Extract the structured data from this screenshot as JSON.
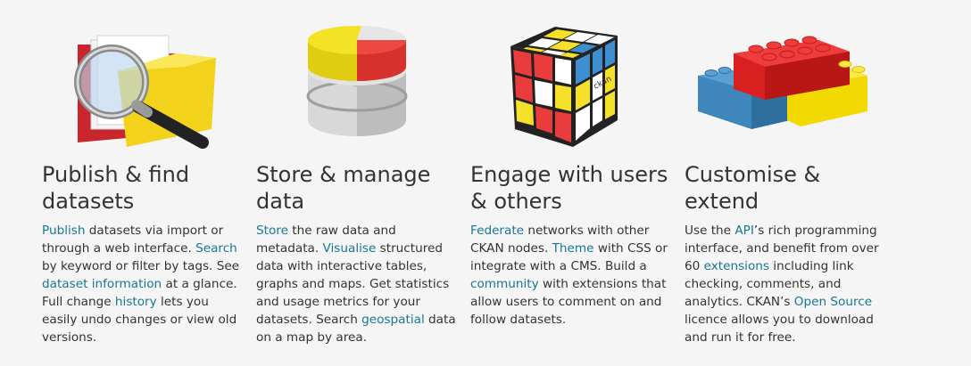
{
  "features": [
    {
      "title_line1": "Publish & find",
      "title_line2": "datasets",
      "icon": "folder-magnifier-icon",
      "desc": [
        {
          "t": "Publish",
          "link": true
        },
        {
          "t": " datasets via import or through a web interface. ",
          "link": false
        },
        {
          "t": "Search",
          "link": true
        },
        {
          "t": " by keyword or filter by tags. See ",
          "link": false
        },
        {
          "t": "dataset information",
          "link": true
        },
        {
          "t": " at a glance. Full change ",
          "link": false
        },
        {
          "t": "history",
          "link": true
        },
        {
          "t": " lets you easily undo changes or view old versions.",
          "link": false
        }
      ]
    },
    {
      "title_line1": "Store & manage",
      "title_line2": "data",
      "icon": "database-pie-icon",
      "desc": [
        {
          "t": "Store",
          "link": true
        },
        {
          "t": " the raw data and metadata. ",
          "link": false
        },
        {
          "t": "Visualise",
          "link": true
        },
        {
          "t": " structured data with interactive tables, graphs and maps. Get statistics and usage metrics for your datasets. Search ",
          "link": false
        },
        {
          "t": "geospatial",
          "link": true
        },
        {
          "t": " data on a map by area.",
          "link": false
        }
      ]
    },
    {
      "title_line1": "Engage with users",
      "title_line2": "& others",
      "icon": "ckan-cube-icon",
      "cube_label": "ckan",
      "desc": [
        {
          "t": "Federate",
          "link": true
        },
        {
          "t": " networks with other CKAN nodes. ",
          "link": false
        },
        {
          "t": "Theme",
          "link": true
        },
        {
          "t": " with CSS or integrate with a CMS. Build a ",
          "link": false
        },
        {
          "t": "community",
          "link": true
        },
        {
          "t": " with extensions that allow users to comment on and follow datasets.",
          "link": false
        }
      ]
    },
    {
      "title_line1": "Customise &",
      "title_line2": "extend",
      "icon": "lego-bricks-icon",
      "desc": [
        {
          "t": "Use the ",
          "link": false
        },
        {
          "t": "API",
          "link": true
        },
        {
          "t": "’s rich programming interface, and benefit from over 60 ",
          "link": false
        },
        {
          "t": "extensions",
          "link": true
        },
        {
          "t": " including link checking, comments, and analytics. CKAN’s ",
          "link": false
        },
        {
          "t": "Open Source",
          "link": true
        },
        {
          "t": " licence allows you to download and run it for free.",
          "link": false
        }
      ]
    }
  ],
  "colors": {
    "text": "#333333",
    "link": "#187794",
    "background": "#f5f5f5"
  }
}
